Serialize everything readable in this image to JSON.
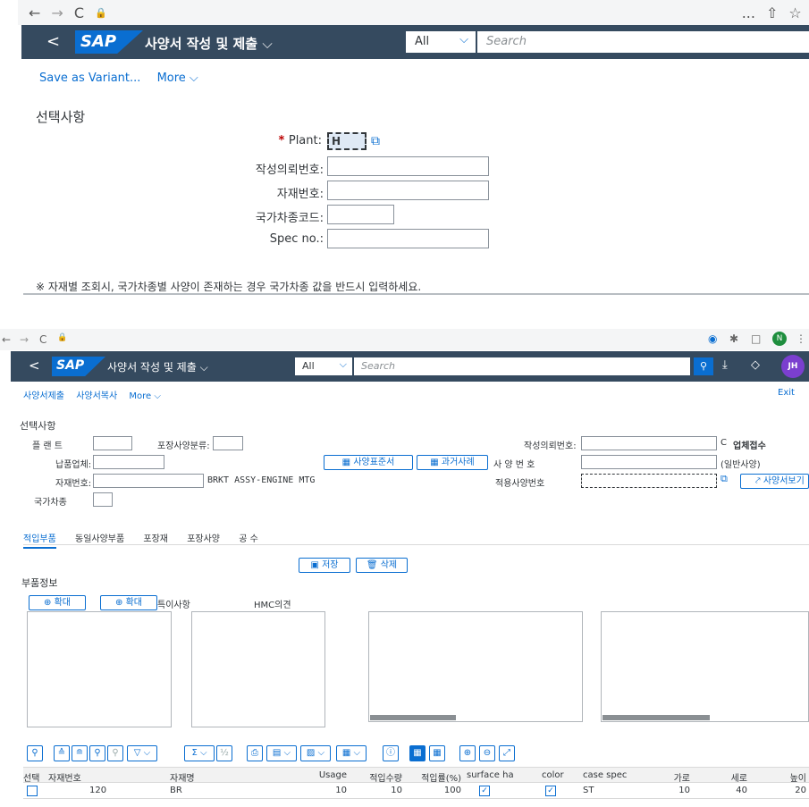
{
  "screen1": {
    "browser": {
      "back": "←",
      "forward": "→",
      "reload": "C",
      "lock": "🔒",
      "more": "...",
      "share": "⇧",
      "star": "☆"
    },
    "shell": {
      "back": "<",
      "logo": "SAP",
      "title": "사양서 작성 및 제출",
      "scope": "All",
      "search_placeholder": "Search"
    },
    "toolbar": {
      "save_variant": "Save as Variant...",
      "more": "More"
    },
    "section_title": "선택사항",
    "fields": {
      "plant_label": "Plant:",
      "plant_value": "H",
      "request_no_label": "작성의뢰번호:",
      "material_no_label": "자재번호:",
      "country_code_label": "국가차종코드:",
      "spec_no_label": "Spec no.:"
    },
    "note": "※ 자재별 조회시, 국가차종별 사양이 존재하는 경우 국가차종 값을 반드시 입력하세요."
  },
  "screen2": {
    "browser": {
      "back": "←",
      "forward": "→",
      "reload": "C",
      "lock": "🔒"
    },
    "shell": {
      "back": "<",
      "logo": "SAP",
      "title": "사양서 작성 및 제출",
      "scope": "All",
      "search_placeholder": "Search",
      "avatar": "JH"
    },
    "toolbar": {
      "submit": "사양서제출",
      "copy": "사양서복사",
      "more": "More",
      "exit": "Exit"
    },
    "section_title": "선택사항",
    "fields": {
      "plant_label": "플 랜 트",
      "packaging_class_label": "포장사양분류:",
      "vendor_label": "납품업체:",
      "material_label": "자재번호:",
      "material_desc": "BRKT ASSY-ENGINE MTG",
      "country_label": "국가차종",
      "request_no_label": "작성의뢰번호:",
      "spec_no_label": "사 양 번 호",
      "applied_spec_label": "적용사양번호",
      "status_c": "C",
      "status_text": "업체접수",
      "spec_type": "(일반사양)"
    },
    "buttons": {
      "std_doc": "사양표준서",
      "past_case": "과거사례",
      "spec_view": "사양서보기",
      "save": "저장",
      "delete": "삭제",
      "zoom1": "확대",
      "zoom2": "확대"
    },
    "tabs": [
      "적입부품",
      "동일사양부품",
      "포장재",
      "포장사양",
      "공 수"
    ],
    "parts_info_title": "부품정보",
    "special_label": "특이사항",
    "hmc_label": "HMC의견",
    "table": {
      "headers": [
        "선택",
        "자재번호",
        "자재명",
        "Usage",
        "적입수량",
        "적입률(%)",
        "surface ha",
        "color",
        "case spec",
        "가로",
        "세로",
        "높이"
      ],
      "row": {
        "material_no": "120",
        "material_name": "BR",
        "usage": "10",
        "qty": "10",
        "rate": "100",
        "surface_check": "✓",
        "color_check": "✓",
        "case_spec": "ST",
        "width": "10",
        "depth": "40",
        "height": "20"
      }
    }
  },
  "colors": {
    "shell": "#354a5f",
    "accent": "#0a6ed1",
    "required": "#bb0000",
    "avatar": "#7b3fcf"
  }
}
